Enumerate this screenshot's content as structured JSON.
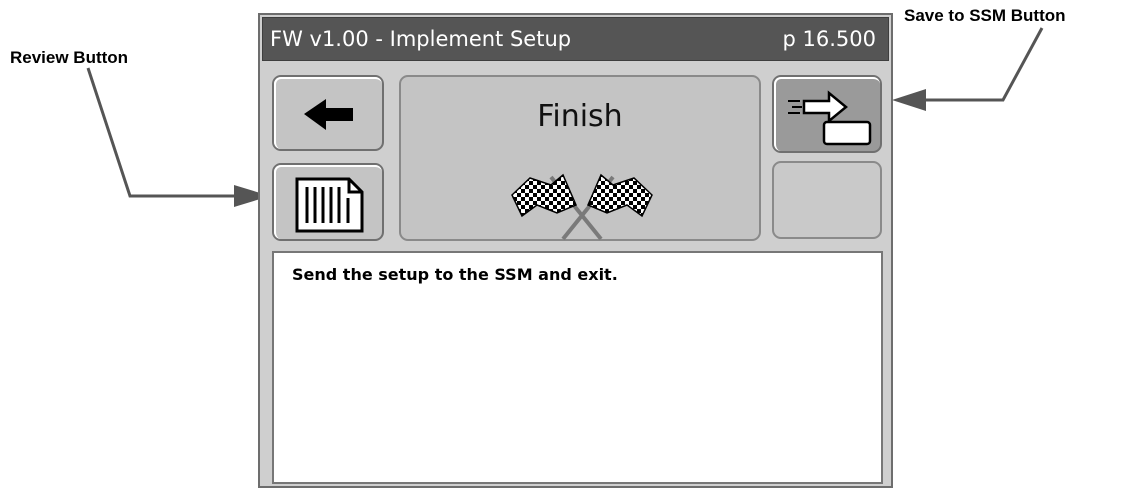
{
  "annotations": {
    "review": "Review Button",
    "save": "Save to SSM Button"
  },
  "header": {
    "title": "FW v1.00 - Implement Setup",
    "page": "p 16.500"
  },
  "step": {
    "label": "Finish",
    "icon": "checkered-flags-icon"
  },
  "buttons": {
    "back_icon": "left-arrow-icon",
    "review_icon": "document-list-icon",
    "save_icon": "send-to-ssm-icon"
  },
  "message": "Send the setup to the SSM and exit.",
  "colors": {
    "titlebar": "#555555",
    "panel": "#c4c4c4",
    "screen": "#cfcfcf"
  }
}
